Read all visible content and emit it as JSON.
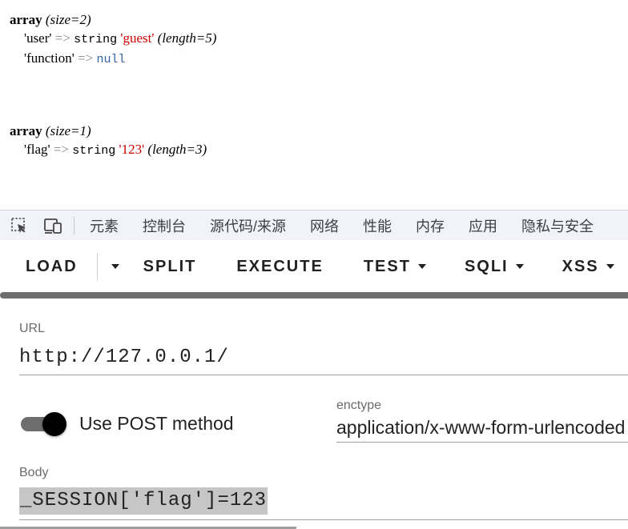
{
  "dump1": {
    "kw": "array",
    "size": "(size=2)",
    "rows": [
      {
        "key": "'user'",
        "arrow": "=>",
        "type": "string",
        "value": "'guest'",
        "length": "(length=5)"
      },
      {
        "key": "'function'",
        "arrow": "=>",
        "value": "null"
      }
    ]
  },
  "dump2": {
    "kw": "array",
    "size": "(size=1)",
    "rows": [
      {
        "key": "'flag'",
        "arrow": "=>",
        "type": "string",
        "value": "'123'",
        "length": "(length=3)"
      }
    ]
  },
  "devtools": {
    "icons": [
      "inspect-icon",
      "device-toggle-icon"
    ],
    "tabs": [
      "元素",
      "控制台",
      "源代码/来源",
      "网络",
      "性能",
      "内存",
      "应用",
      "隐私与安全"
    ]
  },
  "toolbar": {
    "load": "LOAD",
    "split": "SPLIT",
    "execute": "EXECUTE",
    "test": "TEST",
    "sqli": "SQLI",
    "xss": "XSS"
  },
  "form": {
    "url_label": "URL",
    "url_value": "http://127.0.0.1/",
    "post_label": "Use POST method",
    "post_enabled": true,
    "enctype_label": "enctype",
    "enctype_value": "application/x-www-form-urlencoded",
    "body_label": "Body",
    "body_value": "_SESSION['flag']=123"
  },
  "colors": {
    "string": "#cc0000",
    "null": "#3465a4",
    "arrow": "#888a85",
    "toggle_track": "#6e6e6e",
    "toggle_knob": "#000000"
  }
}
